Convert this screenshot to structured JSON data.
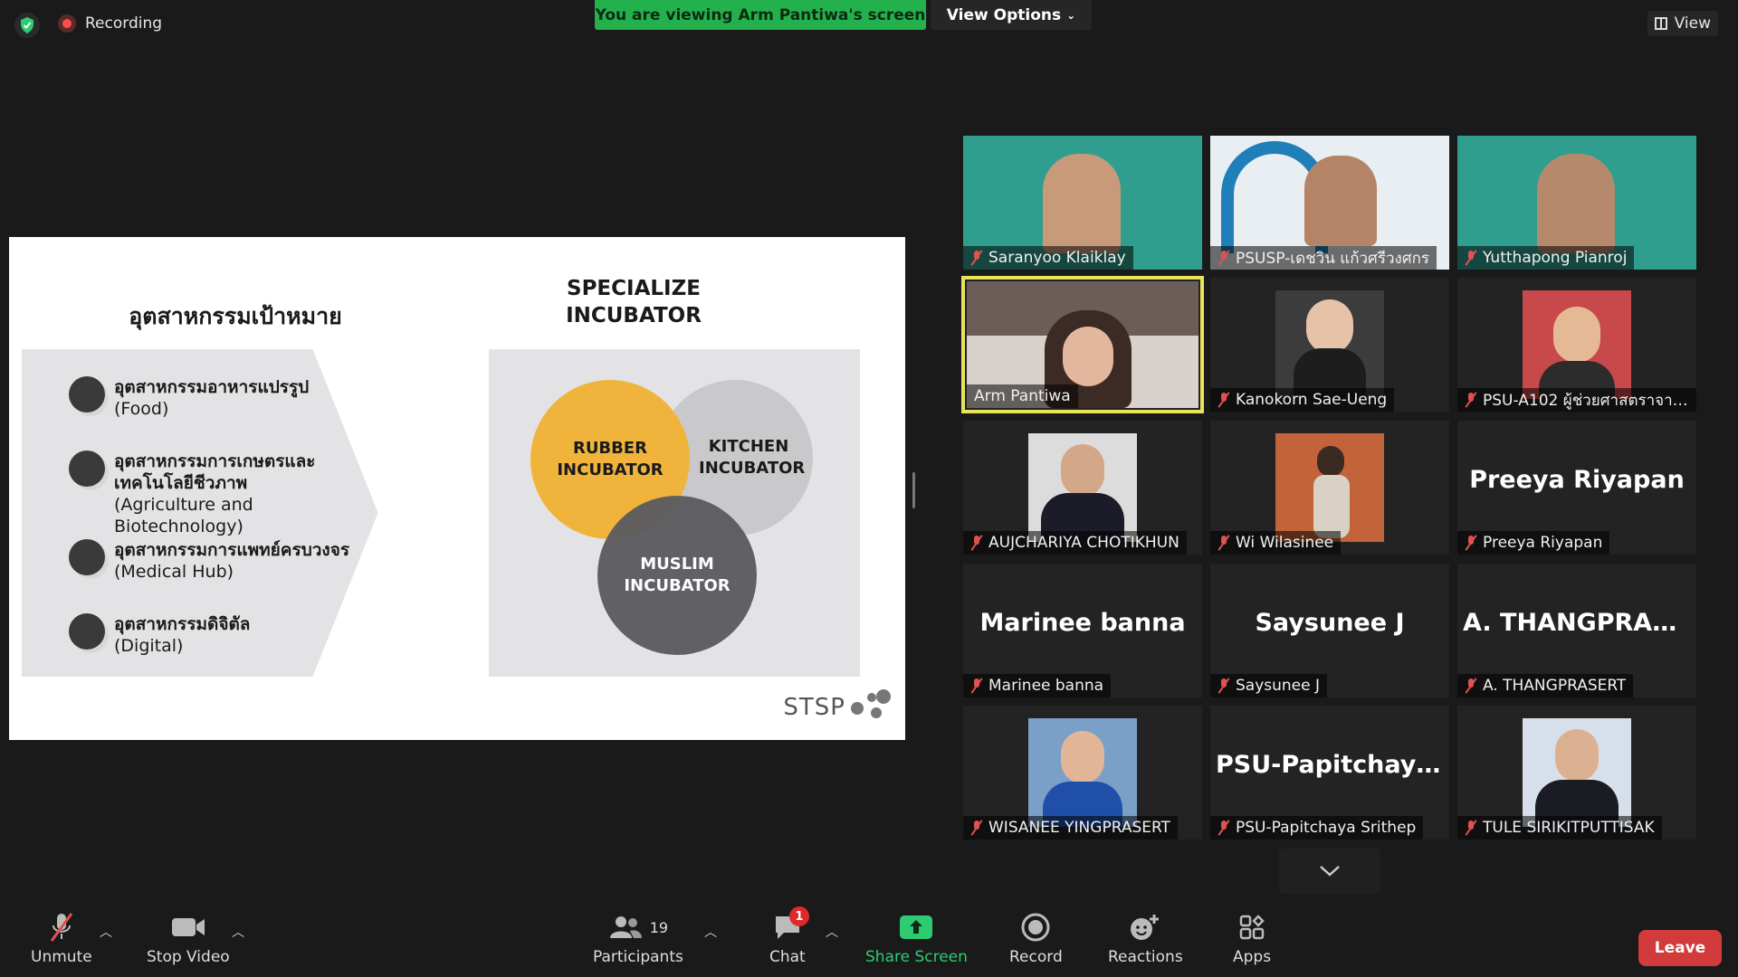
{
  "topbar": {
    "recording_label": "Recording",
    "viewing_label": "You are viewing Arm Pantiwa's screen",
    "view_options_label": "View Options",
    "view_label": "View"
  },
  "slide": {
    "left_title": "อุตสาหกรรมเป้าหมาย",
    "right_title_line1": "SPECIALIZE",
    "right_title_line2": "INCUBATOR",
    "industries": [
      {
        "th": "อุตสาหกรรมอาหารแปรรูป",
        "en": "(Food)"
      },
      {
        "th": "อุตสาหกรรมการเกษตรและ เทคโนโลยีชีวภาพ",
        "en": "(Agriculture and Biotechnology)"
      },
      {
        "th": "อุตสาหกรรมการแพทย์ครบวงจร",
        "en": "(Medical Hub)"
      },
      {
        "th": "อุตสาหกรรมดิจิตัล",
        "en": "(Digital)"
      }
    ],
    "incubators": {
      "rubber": "RUBBER INCUBATOR",
      "kitchen": "KITCHEN INCUBATOR",
      "muslim": "MUSLIM INCUBATOR"
    },
    "logo_text": "STSP",
    "colors": {
      "rubber": "#f0b43c",
      "kitchen": "#c9c9cc",
      "muslim": "#5c5c60",
      "panel": "#e3e3e5"
    }
  },
  "participants": {
    "tiles": [
      {
        "bigname": "",
        "nameplate": "Saranyoo Klaiklay",
        "video": true,
        "bg": "#2f9e8f"
      },
      {
        "bigname": "",
        "nameplate": "PSUSP-เดชวิน แก้วศรีวงศกร",
        "video": true,
        "bg": "#e8eef2"
      },
      {
        "bigname": "",
        "nameplate": "Yutthapong Pianroj",
        "video": true,
        "bg": "#2f9e8f"
      },
      {
        "bigname": "",
        "nameplate": "Arm Pantiwa",
        "video": true,
        "bg": "#c24646"
      },
      {
        "bigname": "",
        "nameplate": "Kanokorn Sae-Ueng",
        "video": false,
        "bg": "#3c3c3c"
      },
      {
        "bigname": "",
        "nameplate": "PSU-A102 ผู้ช่วยศาสตราจาร...",
        "video": false,
        "bg": "#c8494b"
      },
      {
        "bigname": "",
        "nameplate": "AUJCHARIYA CHOTIKHUN",
        "video": false,
        "bg": "#dcdcdc"
      },
      {
        "bigname": "",
        "nameplate": "Wi Wilasinee",
        "video": false,
        "bg": "#c2633a"
      },
      {
        "bigname": "Preeya Riyapan",
        "nameplate": "Preeya Riyapan",
        "video": false,
        "bg": ""
      },
      {
        "bigname": "Marinee banna",
        "nameplate": "Marinee banna",
        "video": false,
        "bg": ""
      },
      {
        "bigname": "Saysunee J",
        "nameplate": "Saysunee J",
        "video": false,
        "bg": ""
      },
      {
        "bigname": "A.  THANGPRAS...",
        "nameplate": "A. THANGPRASERT",
        "video": false,
        "bg": ""
      },
      {
        "bigname": "",
        "nameplate": "WISANEE YINGPRASERT",
        "video": false,
        "bg": "#7aa0c8"
      },
      {
        "bigname": "PSU-Papitchaya...",
        "nameplate": "PSU-Papitchaya Srithep",
        "video": false,
        "bg": ""
      },
      {
        "bigname": "",
        "nameplate": "TULE SIRIKITPUTTISAK",
        "video": false,
        "bg": "#d7e0ea"
      }
    ]
  },
  "toolbar": {
    "unmute_label": "Unmute",
    "stop_video_label": "Stop Video",
    "participants_label": "Participants",
    "participants_count": "19",
    "chat_label": "Chat",
    "chat_badge": "1",
    "share_label": "Share Screen",
    "record_label": "Record",
    "reactions_label": "Reactions",
    "apps_label": "Apps",
    "leave_label": "Leave",
    "accent": "#2ecc71",
    "leave_color": "#d13b3b"
  }
}
